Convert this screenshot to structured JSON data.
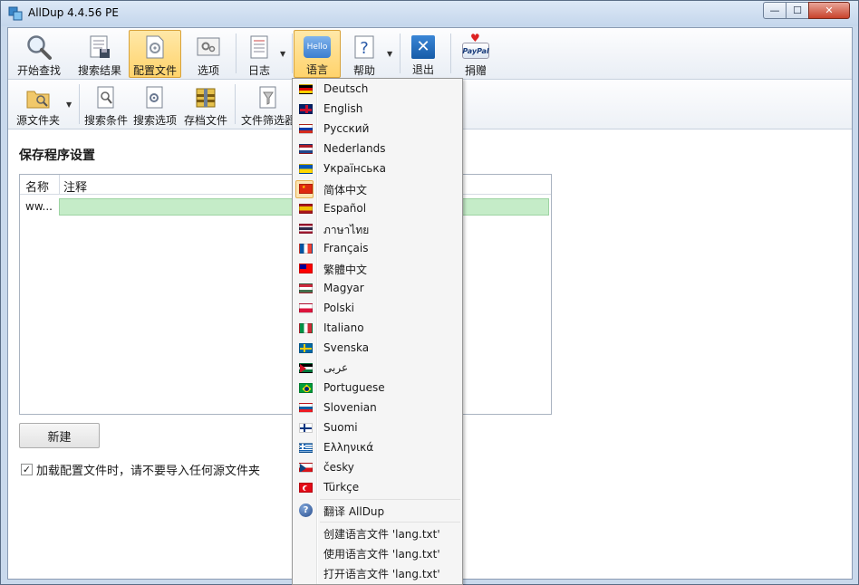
{
  "window": {
    "title": "AllDup 4.4.56 PE",
    "min_glyph": "—",
    "max_glyph": "☐",
    "close_glyph": "✕"
  },
  "toolbar_main": [
    {
      "label": "开始查找",
      "icon": "magnifier-icon"
    },
    {
      "label": "搜索结果",
      "icon": "results-icon"
    },
    {
      "label": "配置文件",
      "icon": "profile-icon",
      "active": true
    },
    {
      "label": "选项",
      "icon": "options-icon"
    },
    {
      "label": "日志",
      "icon": "log-icon"
    },
    {
      "label": "语言",
      "icon": "language-icon",
      "badge": "Hello"
    },
    {
      "label": "帮助",
      "icon": "help-icon"
    },
    {
      "label": "退出",
      "icon": "exit-icon"
    },
    {
      "label": "捐赠",
      "icon": "paypal-icon",
      "badge": "PayPal"
    }
  ],
  "toolbar_sub": [
    {
      "label": "源文件夹",
      "icon": "folder-icon"
    },
    {
      "label": "搜索条件",
      "icon": "search-criteria-icon"
    },
    {
      "label": "搜索选项",
      "icon": "search-options-icon"
    },
    {
      "label": "存档文件",
      "icon": "archive-icon"
    },
    {
      "label": "文件筛选器",
      "icon": "filter-icon"
    }
  ],
  "main": {
    "section_title": "保存程序设置",
    "columns": [
      "名称",
      "注释"
    ],
    "rows": [
      {
        "name": "ww...",
        "note": ""
      }
    ],
    "new_button": "新建",
    "checkbox_label": "加载配置文件时，请不要导入任何源文件夹",
    "checkbox_checked": true
  },
  "language_menu": {
    "items": [
      {
        "label": "Deutsch",
        "flag": "de"
      },
      {
        "label": "English",
        "flag": "gb"
      },
      {
        "label": "Русский",
        "flag": "ru"
      },
      {
        "label": "Nederlands",
        "flag": "nl"
      },
      {
        "label": "Українська",
        "flag": "ua"
      },
      {
        "label": "简体中文",
        "flag": "cn",
        "selected": true
      },
      {
        "label": "Español",
        "flag": "es"
      },
      {
        "label": "ภาษาไทย",
        "flag": "th"
      },
      {
        "label": "Français",
        "flag": "fr"
      },
      {
        "label": "繁體中文",
        "flag": "tw"
      },
      {
        "label": "Magyar",
        "flag": "hu"
      },
      {
        "label": "Polski",
        "flag": "pl"
      },
      {
        "label": "Italiano",
        "flag": "it"
      },
      {
        "label": "Svenska",
        "flag": "se"
      },
      {
        "label": "عربى",
        "flag": "jo"
      },
      {
        "label": "Portuguese",
        "flag": "br"
      },
      {
        "label": "Slovenian",
        "flag": "si"
      },
      {
        "label": "Suomi",
        "flag": "fi"
      },
      {
        "label": "Ελληνικά",
        "flag": "gr"
      },
      {
        "label": "česky",
        "flag": "cz"
      },
      {
        "label": "Türkçe",
        "flag": "tr"
      }
    ],
    "translate_label": "翻译 AllDup",
    "create_label": "创建语言文件 'lang.txt'",
    "use_label": "使用语言文件 'lang.txt'",
    "open_label": "打开语言文件 'lang.txt'"
  },
  "colors": {
    "accent_active": "#ffd36c",
    "row_note_bg": "#c5ecc8",
    "menu_bg": "#f5f5f5"
  }
}
